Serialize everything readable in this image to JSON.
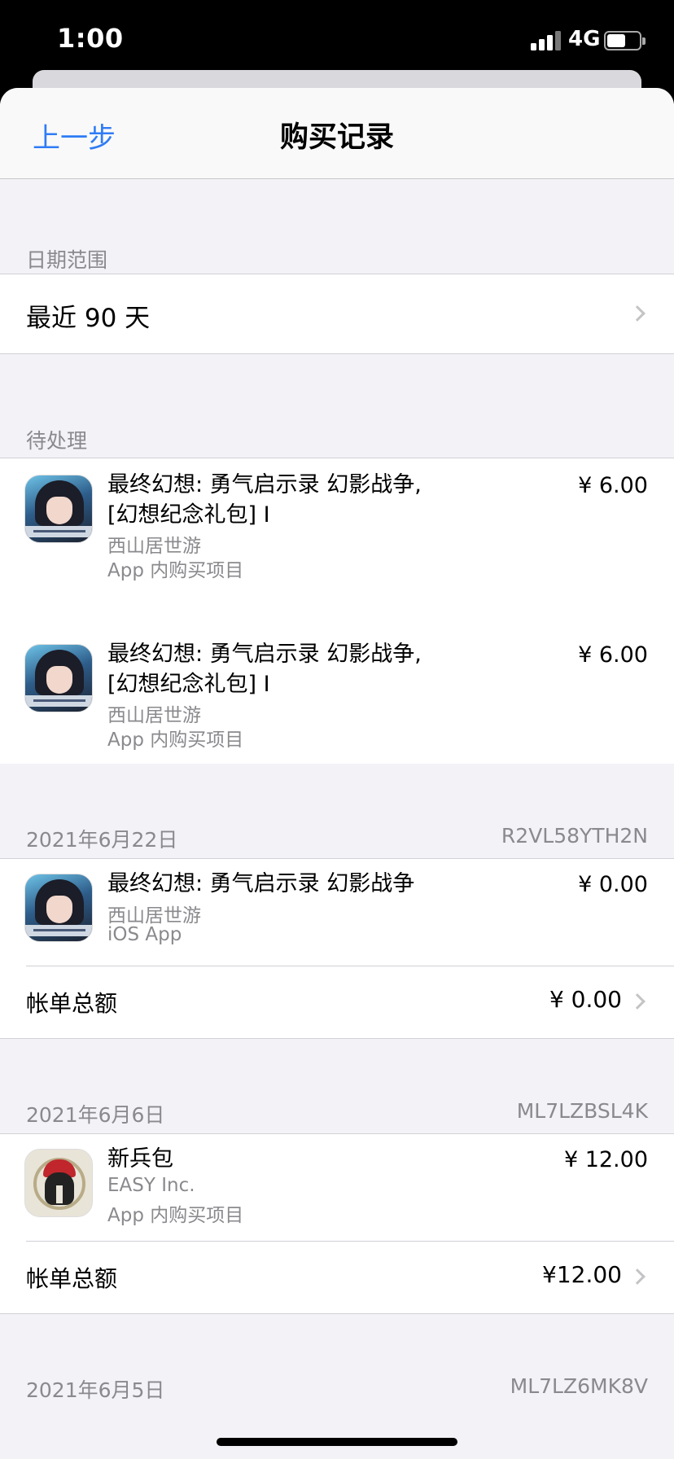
{
  "status": {
    "time": "1:00",
    "network": "4G"
  },
  "nav": {
    "back": "上一步",
    "title": "购买记录"
  },
  "date_range": {
    "header": "日期范围",
    "value": "最近 90 天"
  },
  "pending": {
    "header": "待处理",
    "items": [
      {
        "name": "最终幻想: 勇气启示录 幻影战争, [幻想纪念礼包] I",
        "developer": "西山居世游",
        "type": "App 内购买项目",
        "price": "¥ 6.00",
        "icon": "ffbe-war-of-the-visions-icon"
      },
      {
        "name": "最终幻想: 勇气启示录 幻影战争, [幻想纪念礼包] I",
        "developer": "西山居世游",
        "type": "App 内购买项目",
        "price": "¥ 6.00",
        "icon": "ffbe-war-of-the-visions-icon"
      }
    ]
  },
  "orders": [
    {
      "date": "2021年6月22日",
      "order_id": "R2VL58YTH2N",
      "items": [
        {
          "name": "最终幻想: 勇气启示录 幻影战争",
          "developer": "西山居世游",
          "type": "iOS App",
          "price": "¥ 0.00",
          "icon": "ffbe-war-of-the-visions-icon"
        }
      ],
      "total_label": "帐单总额",
      "total": "¥ 0.00"
    },
    {
      "date": "2021年6月6日",
      "order_id": "ML7LZBSL4K",
      "items": [
        {
          "name": "新兵包",
          "developer": "EASY Inc.",
          "type": "App 内购买项目",
          "price": "¥ 12.00",
          "icon": "spartan-helmet-icon"
        }
      ],
      "total_label": "帐单总额",
      "total": "¥12.00"
    },
    {
      "date": "2021年6月5日",
      "order_id": "ML7LZ6MK8V"
    }
  ]
}
